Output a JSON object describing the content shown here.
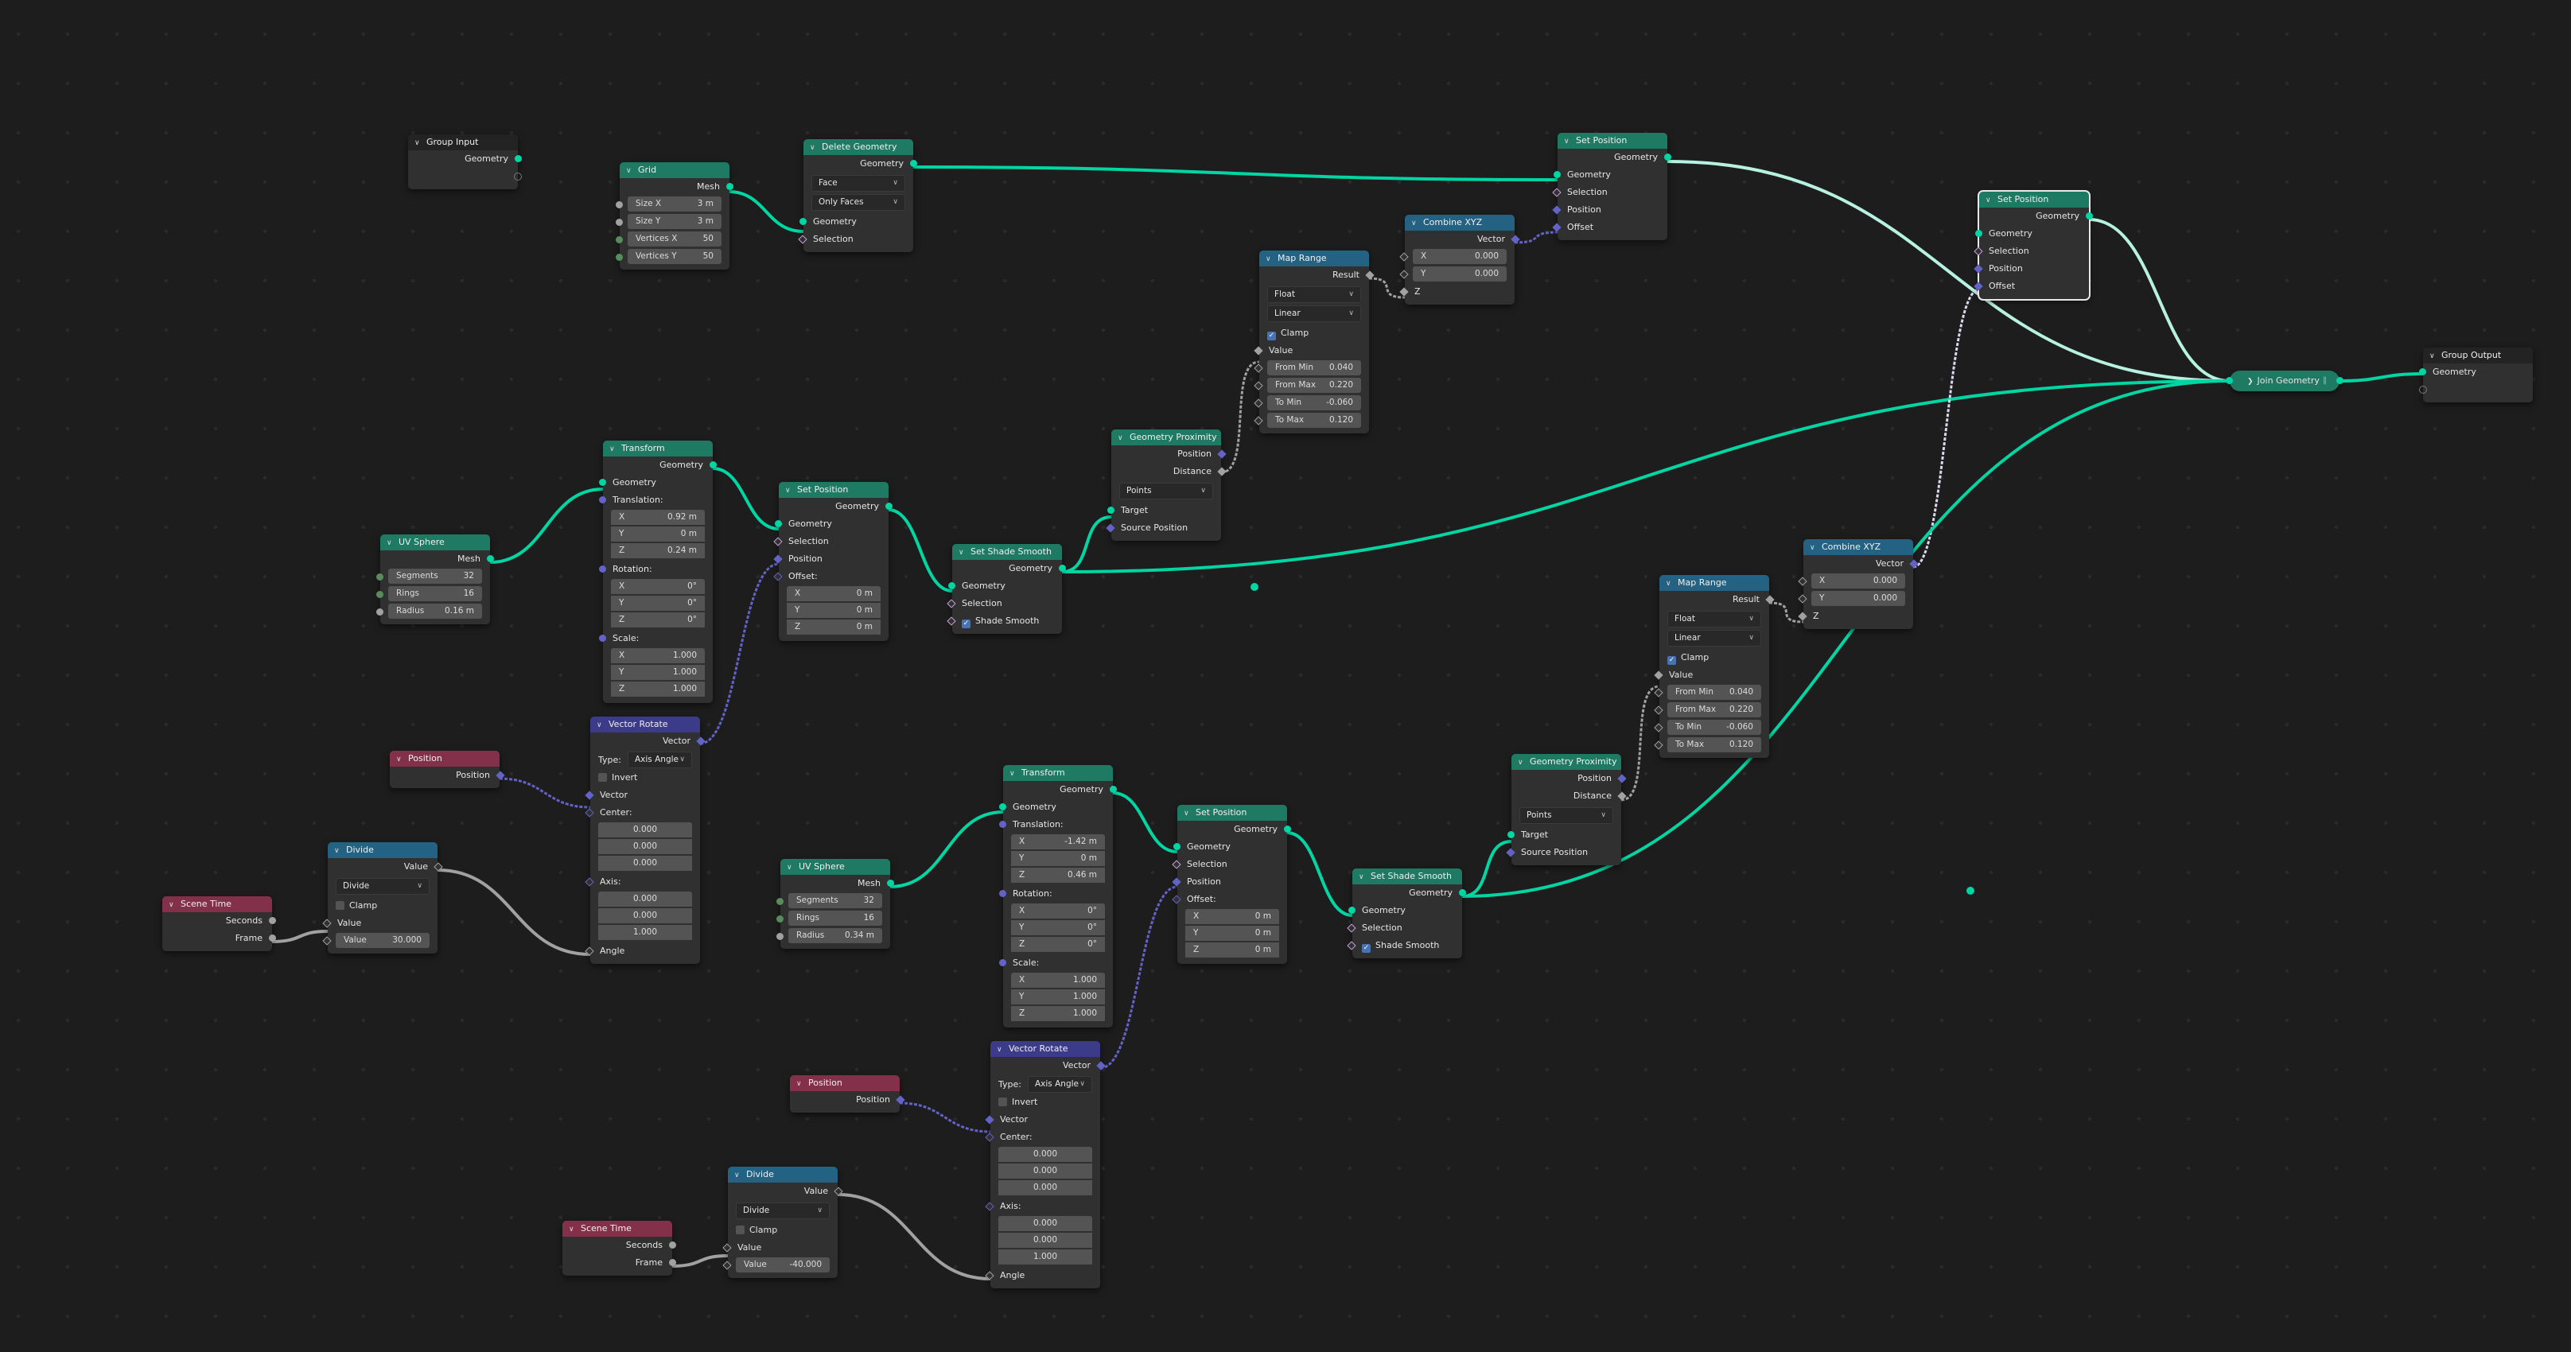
{
  "editor": "Geometry Nodes",
  "colors": {
    "background": "#1d1d1d",
    "node_body": "#303030",
    "header_geometry": "#1e7a63",
    "header_converter": "#246283",
    "header_vector": "#3b3b8a",
    "header_input": "#83314a",
    "socket_geometry": "#00d6a3",
    "socket_vector": "#6363c7",
    "socket_float": "#a1a1a1",
    "socket_int": "#598c5c",
    "socket_bool": "#c9a0dc",
    "checkbox_on": "#4772b3"
  },
  "nodes": {
    "group_input": {
      "title": "Group Input",
      "out_geometry": "Geometry"
    },
    "grid": {
      "title": "Grid",
      "out": "Mesh",
      "fields": [
        {
          "label": "Size X",
          "value": "3 m"
        },
        {
          "label": "Size Y",
          "value": "3 m"
        },
        {
          "label": "Vertices X",
          "value": "50"
        },
        {
          "label": "Vertices Y",
          "value": "50"
        }
      ]
    },
    "delete_geometry": {
      "title": "Delete Geometry",
      "out": "Geometry",
      "domain": "Face",
      "mode": "Only Faces",
      "in_geometry": "Geometry",
      "in_selection": "Selection"
    },
    "set_position_top": {
      "title": "Set Position",
      "out": "Geometry",
      "in_geometry": "Geometry",
      "in_selection": "Selection",
      "in_position": "Position",
      "in_offset": "Offset"
    },
    "combine_xyz_1": {
      "title": "Combine XYZ",
      "out": "Vector",
      "x_label": "X",
      "x": "0.000",
      "y_label": "Y",
      "y": "0.000",
      "z_label": "Z"
    },
    "map_range_1": {
      "title": "Map Range",
      "out": "Result",
      "data_type": "Float",
      "interp": "Linear",
      "clamp_label": "Clamp",
      "clamp": true,
      "value_label": "Value",
      "fields": [
        {
          "label": "From Min",
          "value": "0.040"
        },
        {
          "label": "From Max",
          "value": "0.220"
        },
        {
          "label": "To Min",
          "value": "-0.060"
        },
        {
          "label": "To Max",
          "value": "0.120"
        }
      ]
    },
    "set_position_right": {
      "title": "Set Position",
      "out": "Geometry",
      "in_geometry": "Geometry",
      "in_selection": "Selection",
      "in_position": "Position",
      "in_offset": "Offset"
    },
    "join_geometry": {
      "title": "Join Geometry"
    },
    "group_output": {
      "title": "Group Output",
      "in_geometry": "Geometry"
    },
    "uv_sphere_1": {
      "title": "UV Sphere",
      "out": "Mesh",
      "fields": [
        {
          "label": "Segments",
          "value": "32"
        },
        {
          "label": "Rings",
          "value": "16"
        },
        {
          "label": "Radius",
          "value": "0.16 m"
        }
      ]
    },
    "transform_1": {
      "title": "Transform",
      "out": "Geometry",
      "in_geometry": "Geometry",
      "translation_label": "Translation:",
      "translation": [
        {
          "label": "X",
          "value": "0.92 m"
        },
        {
          "label": "Y",
          "value": "0 m"
        },
        {
          "label": "Z",
          "value": "0.24 m"
        }
      ],
      "rotation_label": "Rotation:",
      "rotation": [
        {
          "label": "X",
          "value": "0°"
        },
        {
          "label": "Y",
          "value": "0°"
        },
        {
          "label": "Z",
          "value": "0°"
        }
      ],
      "scale_label": "Scale:",
      "scale": [
        {
          "label": "X",
          "value": "1.000"
        },
        {
          "label": "Y",
          "value": "1.000"
        },
        {
          "label": "Z",
          "value": "1.000"
        }
      ]
    },
    "set_position_1": {
      "title": "Set Position",
      "out": "Geometry",
      "in_geometry": "Geometry",
      "in_selection": "Selection",
      "in_position": "Position",
      "in_offset": "Offset:",
      "offset": [
        {
          "label": "X",
          "value": "0 m"
        },
        {
          "label": "Y",
          "value": "0 m"
        },
        {
          "label": "Z",
          "value": "0 m"
        }
      ]
    },
    "set_shade_smooth_1": {
      "title": "Set Shade Smooth",
      "out": "Geometry",
      "in_geometry": "Geometry",
      "in_selection": "Selection",
      "shade_smooth_label": "Shade Smooth",
      "shade_smooth": true
    },
    "geometry_proximity_1": {
      "title": "Geometry Proximity",
      "out_position": "Position",
      "out_distance": "Distance",
      "mode": "Points",
      "in_target": "Target",
      "in_source": "Source Position"
    },
    "vector_rotate_1": {
      "title": "Vector Rotate",
      "out": "Vector",
      "type_label": "Type:",
      "type": "Axis Angle",
      "invert_label": "Invert",
      "invert": false,
      "in_vector": "Vector",
      "center_label": "Center:",
      "center": [
        "0.000",
        "0.000",
        "0.000"
      ],
      "axis_label": "Axis:",
      "axis": [
        "0.000",
        "0.000",
        "1.000"
      ],
      "in_angle": "Angle"
    },
    "position_1": {
      "title": "Position",
      "out": "Position"
    },
    "divide_1": {
      "title": "Divide",
      "out": "Value",
      "op": "Divide",
      "clamp_label": "Clamp",
      "clamp": false,
      "in_value": "Value",
      "value_label": "Value",
      "value": "30.000"
    },
    "scene_time_1": {
      "title": "Scene Time",
      "out_seconds": "Seconds",
      "out_frame": "Frame"
    },
    "map_range_2": {
      "title": "Map Range",
      "out": "Result",
      "data_type": "Float",
      "interp": "Linear",
      "clamp_label": "Clamp",
      "clamp": true,
      "value_label": "Value",
      "fields": [
        {
          "label": "From Min",
          "value": "0.040"
        },
        {
          "label": "From Max",
          "value": "0.220"
        },
        {
          "label": "To Min",
          "value": "-0.060"
        },
        {
          "label": "To Max",
          "value": "0.120"
        }
      ]
    },
    "combine_xyz_2": {
      "title": "Combine XYZ",
      "out": "Vector",
      "x_label": "X",
      "x": "0.000",
      "y_label": "Y",
      "y": "0.000",
      "z_label": "Z"
    },
    "geometry_proximity_2": {
      "title": "Geometry Proximity",
      "out_position": "Position",
      "out_distance": "Distance",
      "mode": "Points",
      "in_target": "Target",
      "in_source": "Source Position"
    },
    "uv_sphere_2": {
      "title": "UV Sphere",
      "out": "Mesh",
      "fields": [
        {
          "label": "Segments",
          "value": "32"
        },
        {
          "label": "Rings",
          "value": "16"
        },
        {
          "label": "Radius",
          "value": "0.34 m"
        }
      ]
    },
    "transform_2": {
      "title": "Transform",
      "out": "Geometry",
      "in_geometry": "Geometry",
      "translation_label": "Translation:",
      "translation": [
        {
          "label": "X",
          "value": "-1.42 m"
        },
        {
          "label": "Y",
          "value": "0 m"
        },
        {
          "label": "Z",
          "value": "0.46 m"
        }
      ],
      "rotation_label": "Rotation:",
      "rotation": [
        {
          "label": "X",
          "value": "0°"
        },
        {
          "label": "Y",
          "value": "0°"
        },
        {
          "label": "Z",
          "value": "0°"
        }
      ],
      "scale_label": "Scale:",
      "scale": [
        {
          "label": "X",
          "value": "1.000"
        },
        {
          "label": "Y",
          "value": "1.000"
        },
        {
          "label": "Z",
          "value": "1.000"
        }
      ]
    },
    "set_position_2": {
      "title": "Set Position",
      "out": "Geometry",
      "in_geometry": "Geometry",
      "in_selection": "Selection",
      "in_position": "Position",
      "in_offset": "Offset:",
      "offset": [
        {
          "label": "X",
          "value": "0 m"
        },
        {
          "label": "Y",
          "value": "0 m"
        },
        {
          "label": "Z",
          "value": "0 m"
        }
      ]
    },
    "set_shade_smooth_2": {
      "title": "Set Shade Smooth",
      "out": "Geometry",
      "in_geometry": "Geometry",
      "in_selection": "Selection",
      "shade_smooth_label": "Shade Smooth",
      "shade_smooth": true
    },
    "vector_rotate_2": {
      "title": "Vector Rotate",
      "out": "Vector",
      "type_label": "Type:",
      "type": "Axis Angle",
      "invert_label": "Invert",
      "invert": false,
      "in_vector": "Vector",
      "center_label": "Center:",
      "center": [
        "0.000",
        "0.000",
        "0.000"
      ],
      "axis_label": "Axis:",
      "axis": [
        "0.000",
        "0.000",
        "1.000"
      ],
      "in_angle": "Angle"
    },
    "position_2": {
      "title": "Position",
      "out": "Position"
    },
    "divide_2": {
      "title": "Divide",
      "out": "Value",
      "op": "Divide",
      "clamp_label": "Clamp",
      "clamp": false,
      "in_value": "Value",
      "value_label": "Value",
      "value": "-40.000"
    },
    "scene_time_2": {
      "title": "Scene Time",
      "out_seconds": "Seconds",
      "out_frame": "Frame"
    }
  }
}
